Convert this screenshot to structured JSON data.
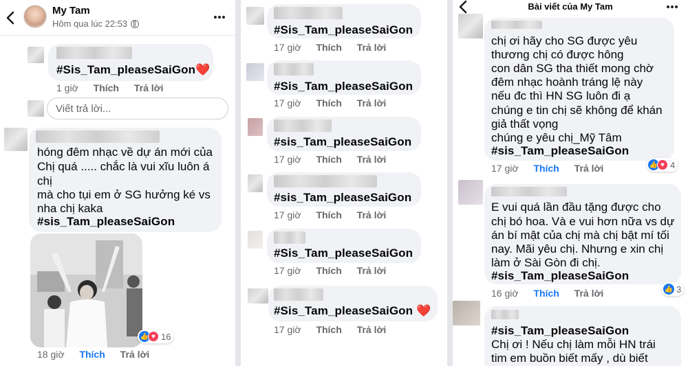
{
  "left": {
    "header": {
      "name": "My Tam",
      "time": "Hôm qua lúc 22:53"
    },
    "comment1": {
      "text": "#Sis_Tam_pleaseSaiGon",
      "emoji": "❤️",
      "time": "1 giờ",
      "like": "Thích",
      "reply": "Trả lời"
    },
    "reply_box": {
      "placeholder": "Viết trả lời..."
    },
    "comment2": {
      "lines": [
        "hóng đêm nhạc về dự án mới của",
        "Chị quá ..... chắc là vui xĩu luôn á",
        "chị",
        "mà cho tụi em ở SG hưởng ké vs",
        "nha chị kaka"
      ],
      "tag": "#sis_Tam_pleaseSaiGon",
      "reactions": "16",
      "time": "18 giờ",
      "like": "Thích",
      "reply": "Trả lời"
    }
  },
  "middle": {
    "comments": [
      {
        "text": "#Sis_Tam_pleaseSaiGon",
        "emoji": "",
        "time": "17 giờ",
        "like": "Thích",
        "reply": "Trả lời"
      },
      {
        "text": "#Sis_Tam_pleaseSaiGon",
        "emoji": "",
        "time": "17 giờ",
        "like": "Thích",
        "reply": "Trả lời"
      },
      {
        "text": "#sis_Tam_pleaseSaiGon",
        "emoji": "",
        "time": "17 giờ",
        "like": "Thích",
        "reply": "Trả lời"
      },
      {
        "text": "#sis_Tam_pleaseSaiGon",
        "emoji": "",
        "time": "17 giờ",
        "like": "Thích",
        "reply": "Trả lời"
      },
      {
        "text": "#Sis_Tam_pleaseSaiGon",
        "emoji": "",
        "time": "17 giờ",
        "like": "Thích",
        "reply": "Trả lời"
      },
      {
        "text": "#Sis_Tam_pleaseSaiGon",
        "emoji": "❤️",
        "time": "17 giờ",
        "like": "Thích",
        "reply": "Trả lời"
      }
    ]
  },
  "right": {
    "header": {
      "title": "Bài viết của My Tam"
    },
    "comment1": {
      "lines": [
        "chị ơi hãy cho SG được yêu",
        "thương chị có được hông",
        "con dân SG tha thiết mong chờ",
        "đêm nhạc hoành tráng lệ này",
        "nếu đc thì HN SG luôn đi ạ",
        "chúng e tin chị sẽ không để khán",
        "giả thất vọng",
        "chúng e yêu chị_Mỹ Tâm"
      ],
      "tag": "#sis_Tam_pleaseSaiGon",
      "reactions": "4",
      "time": "17 giờ",
      "like": "Thích",
      "reply": "Trả lời"
    },
    "comment2": {
      "lines": [
        "E vui quá lần đầu tặng được cho",
        "chị bó hoa. Và e vui hơn nữa vs dự",
        "án bí mật của chị mà chị bật mí tối",
        "nay. Mãi yêu chị. Nhưng e xin chị",
        "làm ở Sài Gòn đi chị."
      ],
      "tag": "#sis_Tam_pleaseSaiGon",
      "reactions": "3",
      "time": "16 giờ",
      "like": "Thích",
      "reply": "Trả lời"
    },
    "comment3": {
      "tag": "#sis_Tam_pleaseSaiGon",
      "lines": [
        "Chị ơi ! Nếu chị làm mỗi HN trái",
        "tim em buồn biết mấy , dù biết"
      ]
    }
  },
  "colors": {
    "like_blue": "#1877f2",
    "heart_red": "#e0393e",
    "meta_gray": "#65676b",
    "bubble": "#f0f2f5"
  }
}
